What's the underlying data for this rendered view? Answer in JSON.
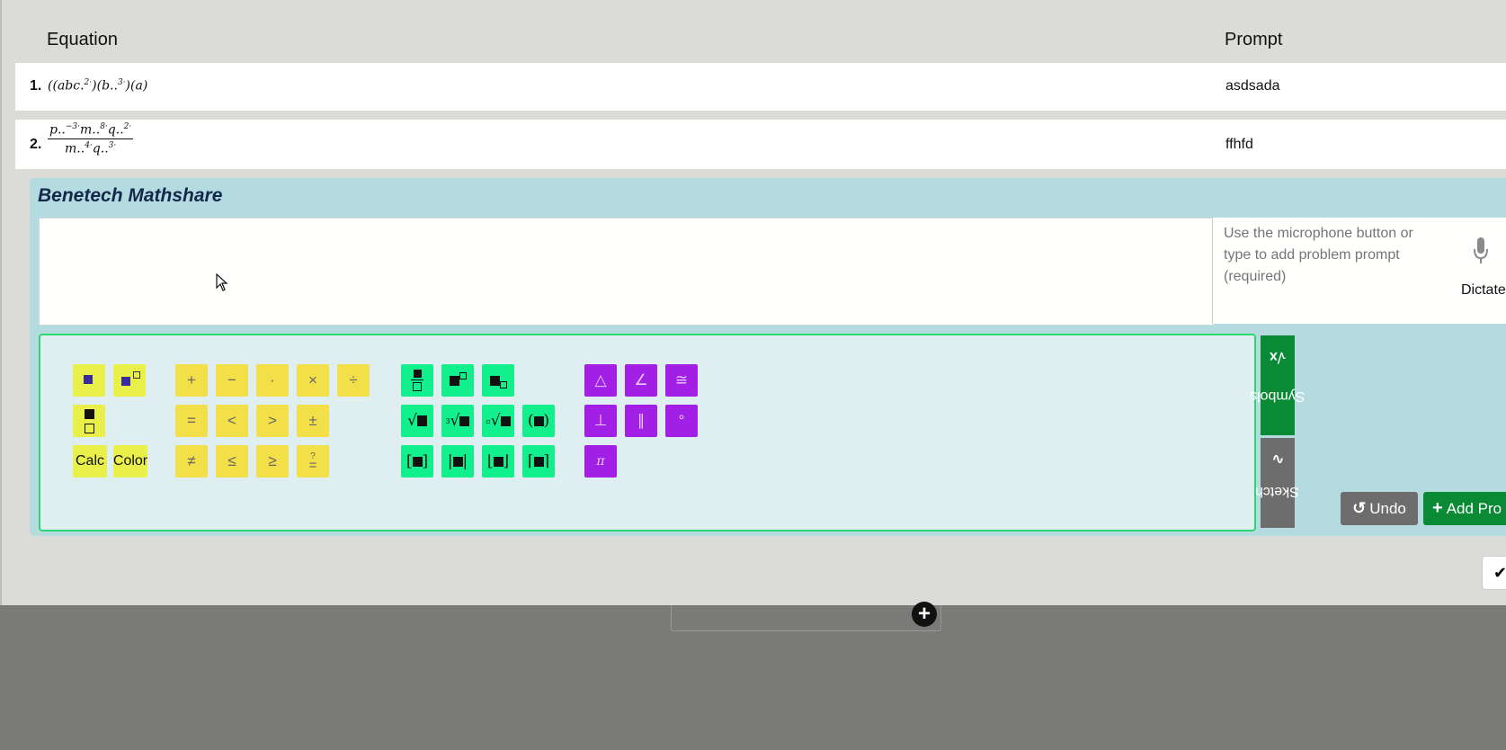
{
  "table": {
    "headers": {
      "equation": "Equation",
      "prompt": "Prompt"
    },
    "rows": [
      {
        "num": "1.",
        "prompt": "asdsada"
      },
      {
        "num": "2.",
        "prompt": "ffhfd"
      }
    ]
  },
  "editor": {
    "brand": "Benetech Mathshare",
    "prompt_placeholder": "Use the microphone button or type to add problem prompt (required)",
    "dictate_label": "Dictate"
  },
  "palette": {
    "calc_label": "Calc",
    "color_label": "Color",
    "operators": [
      "+",
      "−",
      "·",
      "×",
      "÷",
      "=",
      "<",
      ">",
      "±",
      "≠",
      "≤",
      "≥",
      "?="
    ],
    "geometry": [
      "△",
      "∠",
      "≅",
      "⊥",
      "∥",
      "°",
      "π"
    ],
    "tabs": {
      "symbols": "Symbols",
      "sketch": "Sketch"
    }
  },
  "actions": {
    "undo": "Undo",
    "add": "Add Pro"
  },
  "colors": {
    "yellow_tool": "#eaf04a",
    "green_tool": "#12f08e",
    "purple_tool": "#a21fe6",
    "tab_green": "#0a8a35",
    "tab_gray": "#6d6d6d"
  },
  "icons": [
    "mouse-pointer-icon",
    "microphone-icon",
    "undo-icon",
    "plus-icon",
    "check-icon",
    "add-circle-icon",
    "sqrt-icon",
    "pencil-icon"
  ]
}
